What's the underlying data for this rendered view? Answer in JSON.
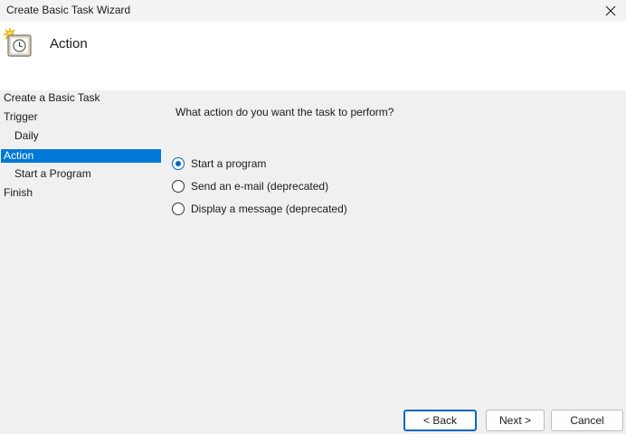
{
  "window": {
    "title": "Create Basic Task Wizard"
  },
  "header": {
    "heading": "Action",
    "icon": "task-scheduler-clock-icon"
  },
  "steps": [
    {
      "label": "Create a Basic Task",
      "indent": false,
      "selected": false
    },
    {
      "label": "Trigger",
      "indent": false,
      "selected": false
    },
    {
      "label": "Daily",
      "indent": true,
      "selected": false
    },
    {
      "label": "Action",
      "indent": false,
      "selected": true
    },
    {
      "label": "Start a Program",
      "indent": true,
      "selected": false
    },
    {
      "label": "Finish",
      "indent": false,
      "selected": false
    }
  ],
  "main": {
    "question": "What action do you want the task to perform?",
    "options": [
      {
        "label": "Start a program",
        "checked": true
      },
      {
        "label": "Send an e-mail (deprecated)",
        "checked": false
      },
      {
        "label": "Display a message (deprecated)",
        "checked": false
      }
    ]
  },
  "buttons": {
    "back": "< Back",
    "next": "Next >",
    "cancel": "Cancel"
  },
  "colors": {
    "selection": "#0078d7",
    "radio_accent": "#0067c0"
  }
}
